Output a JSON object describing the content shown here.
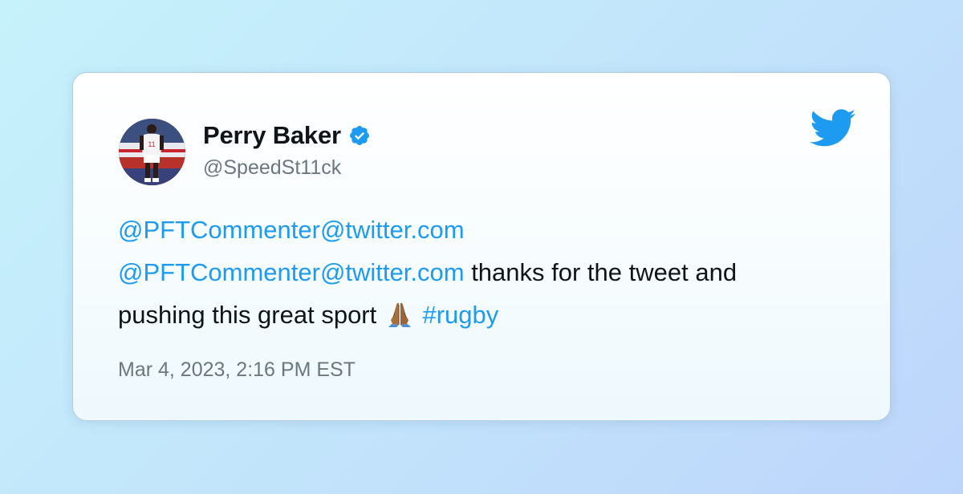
{
  "tweet": {
    "author_name": "Perry Baker",
    "author_handle": "@SpeedSt11ck",
    "verified": true,
    "line1_mention": "@PFTCommenter@twitter.com",
    "line2_mention": "@PFTCommenter@twitter.com",
    "line2_text": " thanks for the tweet and",
    "line3_text": "pushing this great sport ",
    "line3_hashtag": "#rugby",
    "emoji": "folded-hands",
    "timestamp": "Mar 4, 2023, 2:16 PM EST"
  },
  "icons": {
    "brand_logo": "twitter-bird-icon",
    "verified_badge": "verified-badge-icon"
  },
  "colors": {
    "link": "#1d9bf0",
    "text": "#0f1419",
    "muted": "#6b7780",
    "verified": "#1d9bf0",
    "brand": "#1d9bf0"
  }
}
